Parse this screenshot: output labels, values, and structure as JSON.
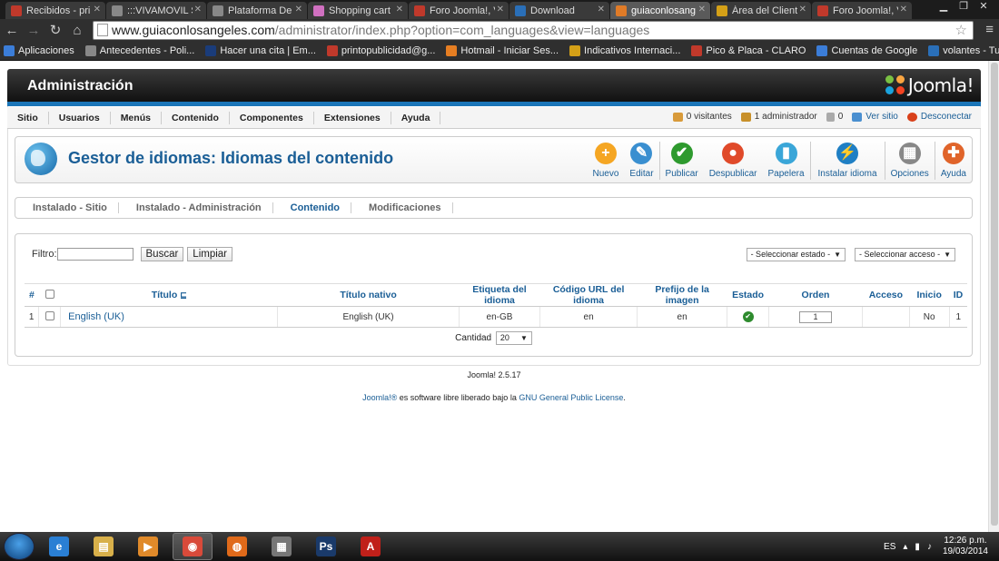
{
  "browser": {
    "tabs": [
      {
        "label": "Recibidos - pri",
        "icon": "gmail-icon",
        "color": "#c0392b",
        "active": false
      },
      {
        "label": ":::VIVAMOVIL S",
        "icon": "page-icon",
        "color": "#888888",
        "active": false
      },
      {
        "label": "Plataforma De",
        "icon": "page-icon",
        "color": "#888888",
        "active": false
      },
      {
        "label": "Shopping cart",
        "icon": "flower-icon",
        "color": "#d070c0",
        "active": false
      },
      {
        "label": "Foro Joomla!, V",
        "icon": "foro-icon",
        "color": "#c0392b",
        "active": false
      },
      {
        "label": "Download",
        "icon": "download-site-icon",
        "color": "#2a6fb8",
        "active": false
      },
      {
        "label": "guiaconlosang",
        "icon": "joomla-icon",
        "color": "#e07b27",
        "active": true
      },
      {
        "label": "Área del Client",
        "icon": "coin-icon",
        "color": "#d4a017",
        "active": false
      },
      {
        "label": "Foro Joomla!, V",
        "icon": "foro-icon",
        "color": "#c0392b",
        "active": false
      }
    ],
    "url_host": "www.guiaconlosangeles.com",
    "url_path": "/administrator/index.php?option=com_languages&view=languages",
    "bookmarks": [
      {
        "label": "Aplicaciones",
        "color": "#3b7dd8"
      },
      {
        "label": "Antecedentes - Poli...",
        "color": "#888888"
      },
      {
        "label": "Hacer una cita | Em...",
        "color": "#1a3c7a"
      },
      {
        "label": "printopublicidad@g...",
        "color": "#c0392b"
      },
      {
        "label": "Hotmail - Iniciar Ses...",
        "color": "#e67e22"
      },
      {
        "label": "Indicativos Internaci...",
        "color": "#d4a017"
      },
      {
        "label": "Pico & Placa - CLARO",
        "color": "#c0392b"
      },
      {
        "label": "Cuentas de Google",
        "color": "#3b7dd8"
      },
      {
        "label": "volantes - Tus Tarjet...",
        "color": "#2a6fb8"
      }
    ]
  },
  "admin": {
    "header_title": "Administración",
    "logo_text": "Joomla!",
    "menu": [
      "Sitio",
      "Usuarios",
      "Menús",
      "Contenido",
      "Componentes",
      "Extensiones",
      "Ayuda"
    ],
    "status": {
      "visitors": "0 visitantes",
      "admins": "1 administrador",
      "messages": "0",
      "view_site": "Ver sitio",
      "logout": "Desconectar"
    },
    "page_title": "Gestor de idiomas: Idiomas del contenido",
    "toolbar": [
      {
        "label": "Nuevo",
        "icon": "plus-icon",
        "color": "#f5a623",
        "glyph": "+"
      },
      {
        "label": "Editar",
        "icon": "pencil-icon",
        "color": "#3a8fd0",
        "glyph": "✎"
      },
      {
        "label": "Publicar",
        "icon": "check-icon",
        "color": "#2e9a2e",
        "glyph": "✔"
      },
      {
        "label": "Despublicar",
        "icon": "stop-icon",
        "color": "#e04a2a",
        "glyph": "●"
      },
      {
        "label": "Papelera",
        "icon": "trash-icon",
        "color": "#3aa6d8",
        "glyph": "▮"
      },
      {
        "label": "Instalar idioma",
        "icon": "lightning-icon",
        "color": "#1f7fc4",
        "glyph": "⚡"
      },
      {
        "label": "Opciones",
        "icon": "options-icon",
        "color": "#888888",
        "glyph": "▦"
      },
      {
        "label": "Ayuda",
        "icon": "lifebuoy-icon",
        "color": "#e0642a",
        "glyph": "✚"
      }
    ],
    "subtabs": [
      {
        "label": "Instalado - Sitio",
        "active": false
      },
      {
        "label": "Instalado - Administración",
        "active": false
      },
      {
        "label": "Contenido",
        "active": true
      },
      {
        "label": "Modificaciones",
        "active": false
      }
    ],
    "filter": {
      "label": "Filtro:",
      "value": "",
      "search_btn": "Buscar",
      "clear_btn": "Limpiar",
      "status_select": "- Seleccionar estado -",
      "access_select": "- Seleccionar acceso -"
    },
    "table": {
      "headers": [
        "#",
        "",
        "Título",
        "Título nativo",
        "Etiqueta del idioma",
        "Código URL del idioma",
        "Prefijo de la imagen",
        "Estado",
        "Orden",
        "Acceso",
        "Inicio",
        "ID"
      ],
      "rows": [
        {
          "num": "1",
          "title": "English (UK)",
          "native": "English (UK)",
          "tag": "en-GB",
          "url_code": "en",
          "image_prefix": "en",
          "status": "published",
          "order": "1",
          "access": "",
          "home": "No",
          "id": "1"
        }
      ]
    },
    "pagination": {
      "label": "Cantidad",
      "value": "20"
    },
    "footer_version": "Joomla! 2.5.17",
    "footer_license_pre": "Joomla!®",
    "footer_license_mid": " es software libre liberado bajo la ",
    "footer_license_link": "GNU General Public License",
    "footer_license_post": "."
  },
  "taskbar": {
    "lang": "ES",
    "time": "12:26 p.m.",
    "date": "19/03/2014",
    "apps": [
      {
        "name": "ie-icon",
        "color": "#2a7fd4",
        "glyph": "e",
        "active": false
      },
      {
        "name": "explorer-icon",
        "color": "#d8b04a",
        "glyph": "▤",
        "active": false
      },
      {
        "name": "media-player-icon",
        "color": "#e08a2a",
        "glyph": "▶",
        "active": false
      },
      {
        "name": "chrome-icon",
        "color": "#d94a3a",
        "glyph": "◉",
        "active": true
      },
      {
        "name": "firefox-icon",
        "color": "#e06a1a",
        "glyph": "◍",
        "active": false
      },
      {
        "name": "network-icon",
        "color": "#777777",
        "glyph": "▦",
        "active": false
      },
      {
        "name": "photoshop-icon",
        "color": "#1a3a6a",
        "glyph": "Ps",
        "active": false
      },
      {
        "name": "acrobat-icon",
        "color": "#c0201a",
        "glyph": "A",
        "active": false
      }
    ]
  }
}
